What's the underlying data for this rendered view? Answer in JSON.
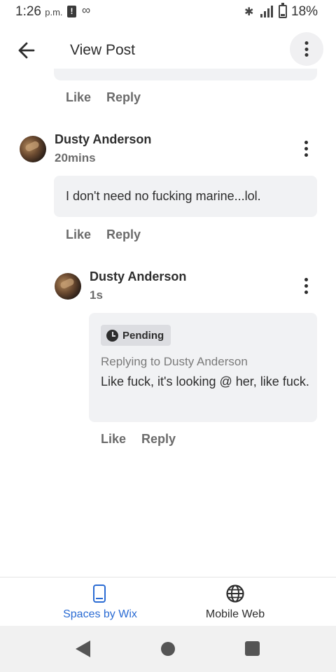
{
  "status_bar": {
    "time": "1:26",
    "ampm": "p.m.",
    "alert_glyph": "!",
    "voicemail_glyph": "∞",
    "bluetooth_glyph": "✱",
    "battery": "18%",
    "icons": [
      "alert-icon",
      "voicemail-icon",
      "bluetooth-icon",
      "signal-icon",
      "battery-icon"
    ]
  },
  "header": {
    "title": "View Post",
    "back_icon": "arrow-left-icon",
    "menu_icon": "more-vertical-icon"
  },
  "previous_comment": {
    "like_label": "Like",
    "reply_label": "Reply"
  },
  "comments": [
    {
      "author": "Dusty Anderson",
      "time": "20mins",
      "text": "I don't need no fucking marine...lol.",
      "like_label": "Like",
      "reply_label": "Reply"
    },
    {
      "author": "Dusty Anderson",
      "time": "1s",
      "status": "Pending",
      "replying_to": "Replying to Dusty Anderson",
      "text": "Like fuck, it's looking @ her, like fuck.",
      "like_label": "Like",
      "reply_label": "Reply"
    }
  ],
  "bottom_nav": {
    "items": [
      {
        "label": "Spaces by Wix",
        "icon": "phone-icon",
        "active": true
      },
      {
        "label": "Mobile Web",
        "icon": "globe-icon",
        "active": false
      }
    ]
  },
  "colors": {
    "accent": "#2a6bd3",
    "bubble": "#f1f2f4",
    "pending_badge": "#dcdde1"
  }
}
